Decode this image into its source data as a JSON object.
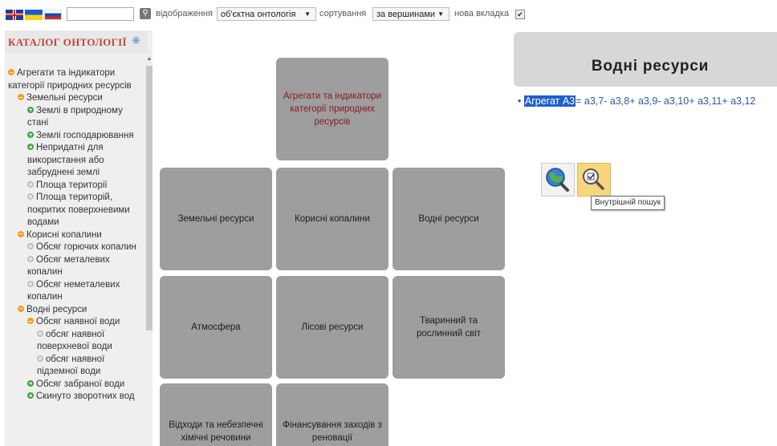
{
  "toolbar": {
    "search_value": "",
    "display_label": "відображення",
    "display_value": "об'єктна онтологія",
    "sort_label": "сортування",
    "sort_value": "за вершинами",
    "new_tab_label": "нова вкладка",
    "new_tab_checked": true
  },
  "catalog": {
    "title": "КАТАЛОГ ОНТОЛОГІЇ",
    "items": [
      {
        "label": "Агрегати та індикатори категорії природних ресурсів",
        "icon": "orange-minus",
        "level": 0
      },
      {
        "label": "Земельні ресурси",
        "icon": "orange-minus",
        "level": 1
      },
      {
        "label": "Землі в природному стані",
        "icon": "green-plus",
        "level": 2
      },
      {
        "label": "Землі господарювання",
        "icon": "green-plus",
        "level": 2
      },
      {
        "label": "Непридатні для використання або забруднені землі",
        "icon": "green-plus",
        "level": 2
      },
      {
        "label": "Площа території",
        "icon": "grey-circle",
        "level": 2
      },
      {
        "label": "Площа територій, покритих поверхневими водами",
        "icon": "grey-circle",
        "level": 2
      },
      {
        "label": "Корисні копалини",
        "icon": "orange-minus",
        "level": 1
      },
      {
        "label": "Обсяг горючих копалин",
        "icon": "grey-circle",
        "level": 2
      },
      {
        "label": "Обсяг металевих копалин",
        "icon": "grey-circle",
        "level": 2
      },
      {
        "label": "Обсяг неметалевих копалин",
        "icon": "grey-circle",
        "level": 2
      },
      {
        "label": "Водні ресурси",
        "icon": "orange-minus",
        "level": 1
      },
      {
        "label": "Обсяг наявної води",
        "icon": "orange-minus",
        "level": 2
      },
      {
        "label": "обсяг наявної поверхневої води",
        "icon": "grey-circle",
        "level": 3
      },
      {
        "label": "обсяг наявної підземної води",
        "icon": "grey-circle",
        "level": 3
      },
      {
        "label": "Обсяг забраної води",
        "icon": "green-plus",
        "level": 2
      },
      {
        "label": "Скинуто зворотних вод",
        "icon": "green-plus",
        "level": 2
      }
    ]
  },
  "tiles": {
    "top": "Агрегати та індикатори категорії природних ресурсів",
    "land": "Земельні ресурси",
    "minerals": "Корисні копалини",
    "water": "Водні ресурси",
    "atmosphere": "Атмосфера",
    "forest": "Лісові ресурси",
    "fauna_flora": "Тваринний та рослинний світ",
    "waste": "Відходи та небезпечні хімічні речовини",
    "financing": "Фінансування заходів з реновації"
  },
  "right_panel": {
    "title": "Водні ресурси",
    "bullet": "•",
    "formula_highlight": "Агрегат А3",
    "formula_rest": "= а3,7- а3,8+ а3,9- а3,10+ а3,11+ а3,12",
    "tooltip": "Внутрішній пошук"
  },
  "colors": {
    "tile": "#9e9e9e",
    "catalog_title": "#c0443c",
    "highlight": "#1e5fcf",
    "inner_search_bg": "#f8d67e"
  }
}
